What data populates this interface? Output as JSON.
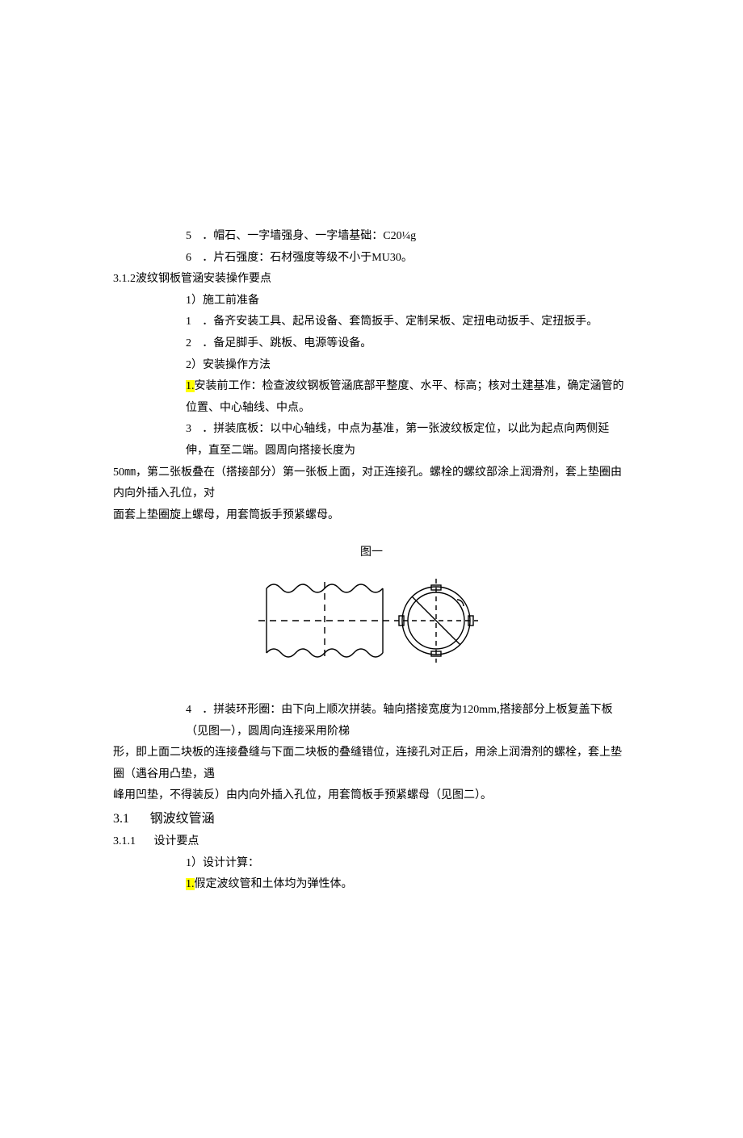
{
  "lines": {
    "l5": "．帽石、一字墙强身、一字墙基础：C20¼g",
    "l6": "．片石强度：石材强度等级不小于MU30。",
    "h312": "3.1.2波纹钢板管涵安装操作要点",
    "s1": "1）施工前准备",
    "s1_1": "．备齐安装工具、起吊设备、套筒扳手、定制呆板、定扭电动扳手、定扭扳手。",
    "s1_2": "．备足脚手、跳板、电源等设备。",
    "s2": "2）安装操作方法",
    "s2_hl": "1.",
    "s2_1": "安装前工作：检查波纹钢板管涵底部平整度、水平、标高；核对土建基准，确定涵管的位置、中心轴线、中点。",
    "s3_a": "．拼装底板：以中心轴线，中点为基准，第一张波纹板定位，以此为起点向两侧延伸，直至二端。圆周向搭接长度为",
    "s3_b": "50㎜，第二张板叠在（搭接部分）第一张板上面，对正连接孔。螺栓的螺纹部涂上润滑剂，套上垫圈由内向外插入孔位，对",
    "s3_c": "面套上垫圈旋上螺母，用套筒扳手预紧螺母。",
    "fig_label": "图一",
    "s4_a": "．拼装环形圈：由下向上顺次拼装。轴向搭接宽度为120mm,搭接部分上板复盖下板（见图一），圆周向连接采用阶梯",
    "s4_b": "形，即上面二块板的连接叠缝与下面二块板的叠缝错位，连接孔对正后，用涂上润滑剂的螺栓，套上垫圈（遇谷用凸垫，遇",
    "s4_c": "峰用凹垫，不得装反）由内向外插入孔位，用套筒板手预紧螺母（见图二）。",
    "h31a": "3.1",
    "h31b": "钢波纹管涵",
    "h311a": "3.1.1",
    "h311b": "设计要点",
    "d1": "1）设计计算：",
    "d1_hl": "1.",
    "d1_1": "假定波纹管和土体均为弹性体。"
  }
}
